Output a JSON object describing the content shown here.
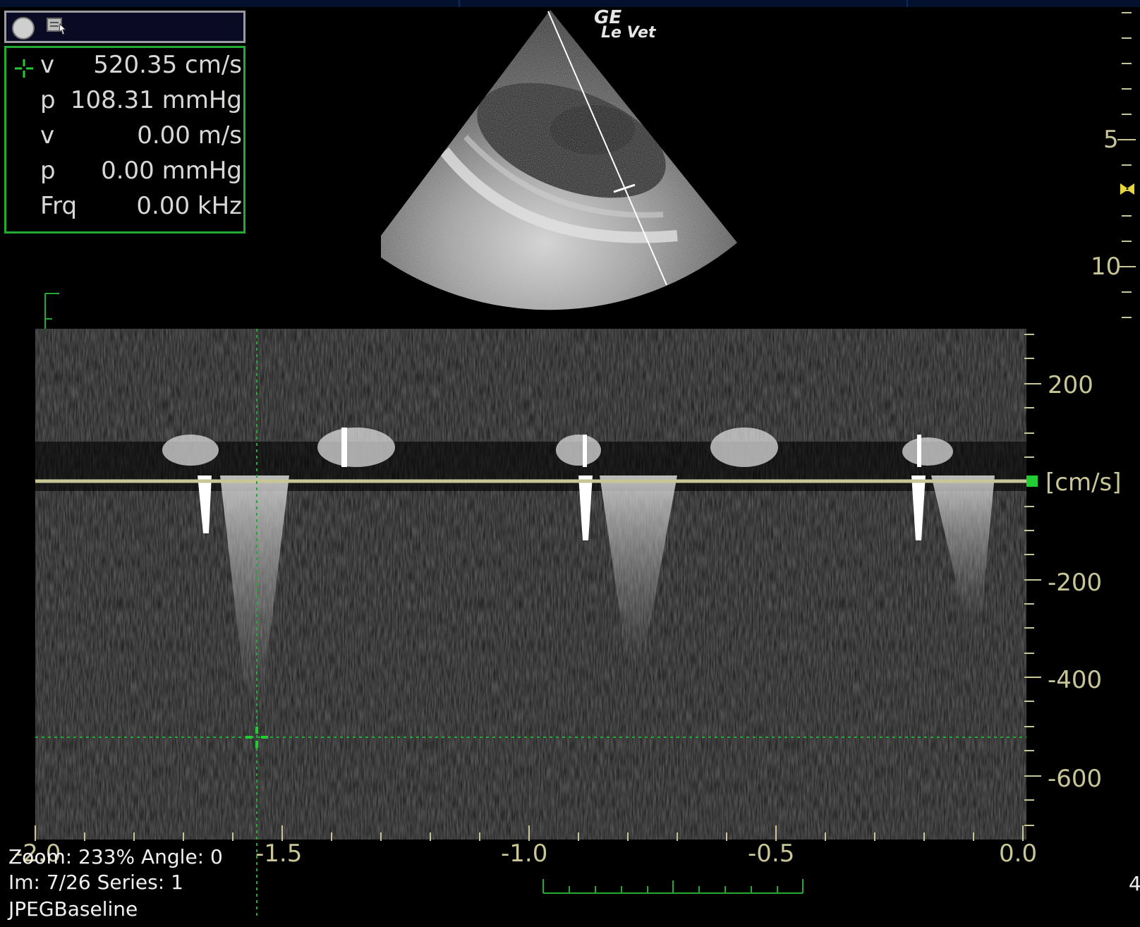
{
  "toolbar": {
    "record_icon": "record-circle-icon",
    "tool_icon": "image-select-icon"
  },
  "measurements": [
    {
      "label": "v",
      "value": "520.35 cm/s"
    },
    {
      "label": "p",
      "value": "108.31 mmHg"
    },
    {
      "label": "v",
      "value": "0.00 m/s"
    },
    {
      "label": "p",
      "value": "0.00 mmHg"
    },
    {
      "label": "Frq",
      "value": "0.00 kHz"
    }
  ],
  "brand": {
    "name": "GE",
    "model": "Le Vet"
  },
  "depth_scale": {
    "labels": [
      "5",
      "10"
    ]
  },
  "velocity_axis": {
    "labels": [
      "200",
      "-200",
      "-400",
      "-600"
    ],
    "unit": "[cm/s]"
  },
  "time_axis": {
    "labels": [
      "-2.0",
      "-1.5",
      "-1.0",
      "-0.5",
      "0.0"
    ]
  },
  "status": {
    "zoom": "Zoom: 233% Angle: 0",
    "image": "Im: 7/26   Series:  1",
    "format": "JPEGBaseline",
    "edge": "4"
  },
  "colors": {
    "baseline": "#c8c596",
    "cursor": "#22cc33",
    "scale_text": "#c8c596"
  }
}
